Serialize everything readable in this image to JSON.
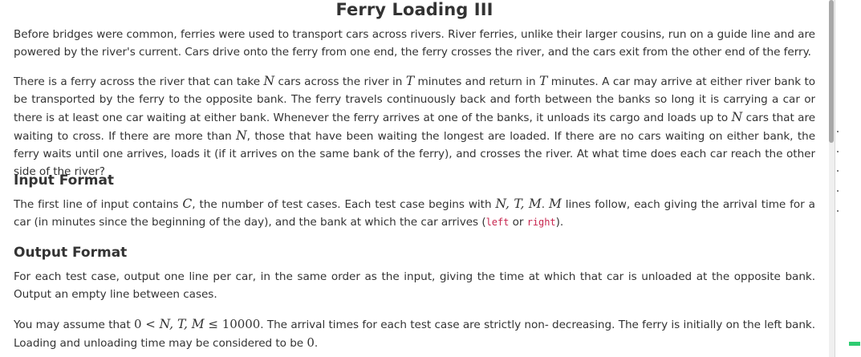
{
  "title": "Ferry Loading III",
  "p1": "Before bridges were common, ferries were used to transport cars across rivers. River ferries, unlike their larger cousins, run on a guide line and are powered by the river's current. Cars drive onto the ferry from one end, the ferry crosses the river, and the cars exit from the other end of the ferry.",
  "p2": {
    "a": "There is a ferry across the river that can take ",
    "N1": "N",
    "b": " cars across the river in ",
    "T1": "T",
    "c": " minutes and return in ",
    "T2": "T",
    "d": " minutes. A car may arrive at either river bank to be transported by the ferry to the opposite bank. The ferry travels continuously back and forth between the banks so long it is carrying a car or there is at least one car waiting at either bank. Whenever the ferry arrives at one of the banks, it unloads its cargo and loads up to ",
    "N2": "N",
    "e": " cars that are waiting to cross. If there are more than ",
    "N3": "N",
    "f": ", those that have been waiting the longest are loaded. If there are no cars waiting on either bank, the ferry waits until one arrives, loads it (if it arrives on the same bank of the ferry), and crosses the river. At what time does each car reach the other side of the river?"
  },
  "input_heading": "Input Format",
  "p3": {
    "a": "The first line of input contains ",
    "C": "C",
    "b": ", the number of test cases. Each test case begins with ",
    "NTM": "N, T, M",
    "c": ". ",
    "M": "M",
    "d": " lines follow, each giving the arrival time for a car (in minutes since the beginning of the day), and the bank at which the car arrives (",
    "left": "left",
    "or": " or ",
    "right": "right",
    "e": ")."
  },
  "output_heading": "Output Format",
  "p4": "For each test case, output one line per car, in the same order as the input, giving the time at which that car is unloaded at the opposite bank. Output an empty line between cases.",
  "p5": {
    "a": "You may assume that ",
    "zero": "0",
    "lt": " < ",
    "vars": "N, T, M",
    "le": " ≤ ",
    "max": "10000",
    "b": ". The arrival times for each test case are strictly non- decreasing. The ferry is initially on the left bank. Loading and unloading time may be considered to be ",
    "zero2": "0",
    "c": "."
  },
  "colors": {
    "text": "#333333",
    "code": "#c7254e",
    "accent": "#2ecc71"
  }
}
